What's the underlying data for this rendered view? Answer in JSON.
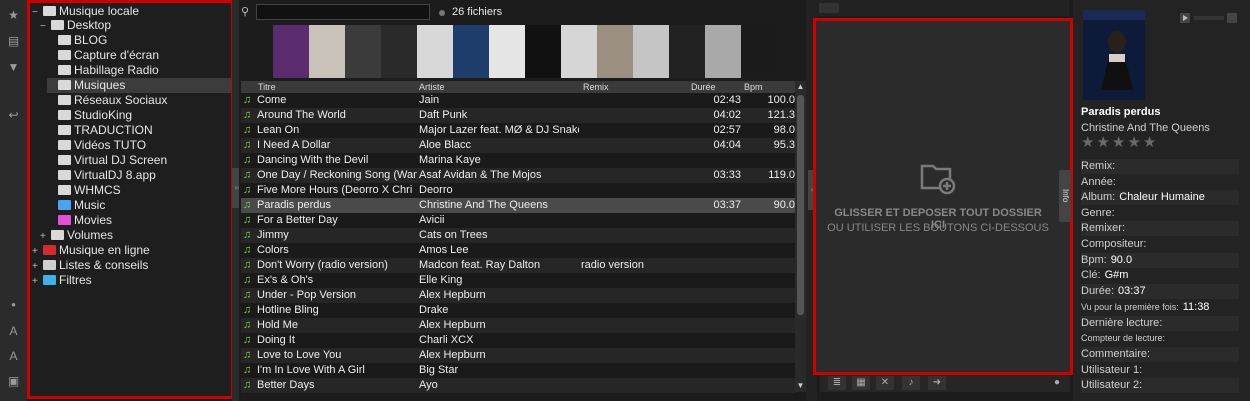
{
  "tree": {
    "root": "Musique locale",
    "desktop": "Desktop",
    "folders": [
      "BLOG",
      "Capture d'écran",
      "Habillage Radio",
      "Musiques",
      "Réseaux Sociaux",
      "StudioKing",
      "TRADUCTION",
      "Vidéos TUTO",
      "Virtual DJ Screen",
      "VirtualDJ 8.app",
      "WHMCS"
    ],
    "music": "Music",
    "movies": "Movies",
    "volumes": "Volumes",
    "online": "Musique en ligne",
    "lists": "Listes & conseils",
    "filters": "Filtres"
  },
  "search": {
    "placeholder": ""
  },
  "file_count": "26 fichiers",
  "table": {
    "headers": {
      "title": "Titre",
      "artist": "Artiste",
      "remix": "Remix",
      "duration": "Durée",
      "bpm": "Bpm"
    },
    "rows": [
      {
        "title": "Come",
        "artist": "Jain",
        "remix": "",
        "duration": "02:43",
        "bpm": "100.0"
      },
      {
        "title": "Around The World",
        "artist": "Daft Punk",
        "remix": "",
        "duration": "04:02",
        "bpm": "121.3"
      },
      {
        "title": "Lean On",
        "artist": "Major Lazer feat. MØ & DJ Snake",
        "remix": "",
        "duration": "02:57",
        "bpm": "98.0"
      },
      {
        "title": "I Need A Dollar",
        "artist": "Aloe Blacc",
        "remix": "",
        "duration": "04:04",
        "bpm": "95.3"
      },
      {
        "title": "Dancing With the Devil",
        "artist": "Marina Kaye",
        "remix": "",
        "duration": "",
        "bpm": ""
      },
      {
        "title": "One Day / Reckoning Song (Wank",
        "artist": "Asaf Avidan & The Mojos",
        "remix": "",
        "duration": "03:33",
        "bpm": "119.0"
      },
      {
        "title": "Five More Hours (Deorro X Chri",
        "artist": "Deorro",
        "remix": "",
        "duration": "",
        "bpm": ""
      },
      {
        "title": "Paradis perdus",
        "artist": "Christine And The Queens",
        "remix": "",
        "duration": "03:37",
        "bpm": "90.0"
      },
      {
        "title": "For a Better Day",
        "artist": "Avicii",
        "remix": "",
        "duration": "",
        "bpm": ""
      },
      {
        "title": "Jimmy",
        "artist": "Cats on Trees",
        "remix": "",
        "duration": "",
        "bpm": ""
      },
      {
        "title": "Colors",
        "artist": "Amos Lee",
        "remix": "",
        "duration": "",
        "bpm": ""
      },
      {
        "title": "Don't Worry (radio version)",
        "artist": "Madcon feat. Ray Dalton",
        "remix": "radio version",
        "duration": "",
        "bpm": ""
      },
      {
        "title": "Ex's & Oh's",
        "artist": "Elle King",
        "remix": "",
        "duration": "",
        "bpm": ""
      },
      {
        "title": "Under - Pop Version",
        "artist": "Alex Hepburn",
        "remix": "",
        "duration": "",
        "bpm": ""
      },
      {
        "title": "Hotline Bling",
        "artist": "Drake",
        "remix": "",
        "duration": "",
        "bpm": ""
      },
      {
        "title": "Hold Me",
        "artist": "Alex Hepburn",
        "remix": "",
        "duration": "",
        "bpm": ""
      },
      {
        "title": "Doing It",
        "artist": "Charli XCX",
        "remix": "",
        "duration": "",
        "bpm": ""
      },
      {
        "title": "Love to Love You",
        "artist": "Alex Hepburn",
        "remix": "",
        "duration": "",
        "bpm": ""
      },
      {
        "title": "I'm In Love With A Girl",
        "artist": "Big Star",
        "remix": "",
        "duration": "",
        "bpm": ""
      },
      {
        "title": "Better Days",
        "artist": "Ayo",
        "remix": "",
        "duration": "",
        "bpm": ""
      }
    ],
    "selected_index": 7
  },
  "covers": [
    "#5a2b6e",
    "#c9c2b8",
    "#3b3b3b",
    "#2a2a2a",
    "#d8d8d8",
    "#1f3d6b",
    "#e5e5e5",
    "#111111",
    "#d6d6d6",
    "#9a8f80",
    "#c5c5c5",
    "#222222",
    "#a9a9a9",
    "#1b1b1b"
  ],
  "sideview": {
    "line1": "GLISSER ET DEPOSER TOUT DOSSIER ICI",
    "line2": "OU UTILISER LES BOUTONS CI-DESSOUS"
  },
  "info_tab": "Info",
  "info": {
    "title": "Paradis perdus",
    "artist": "Christine And The Queens",
    "remix_label": "Remix:",
    "year_label": "Année:",
    "album_label": "Album:",
    "album": "Chaleur Humaine",
    "genre_label": "Genre:",
    "remixer_label": "Remixer:",
    "composer_label": "Compositeur:",
    "bpm_label": "Bpm:",
    "bpm": "90.0",
    "key_label": "Clé:",
    "key": "G#m",
    "duration_label": "Durée:",
    "duration": "03:37",
    "first_seen_label": "Vu pour la première fois:",
    "first_seen": "11:38",
    "last_play_label": "Dernière lecture:",
    "play_count_label": "Compteur de lecture:",
    "comment_label": "Commentaire:",
    "user1_label": "Utilisateur 1:",
    "user2_label": "Utilisateur 2:"
  },
  "colors": {
    "accent_border": "#d10000",
    "note_icon": "#7fd13b"
  }
}
